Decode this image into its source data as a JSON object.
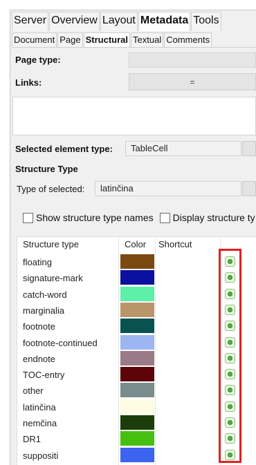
{
  "main_tabs": [
    {
      "label": "Server",
      "active": false
    },
    {
      "label": "Overview",
      "active": false
    },
    {
      "label": "Layout",
      "active": false
    },
    {
      "label": "Metadata",
      "active": true
    },
    {
      "label": "Tools",
      "active": false
    }
  ],
  "sub_tabs": [
    {
      "label": "Document",
      "active": false
    },
    {
      "label": "Page",
      "active": false
    },
    {
      "label": "Structural",
      "active": true
    },
    {
      "label": "Textual",
      "active": false
    },
    {
      "label": "Comments",
      "active": false
    }
  ],
  "page_type_label": "Page type:",
  "links_label": "Links:",
  "links_button_symbol": "=",
  "selected_element": {
    "label": "Selected element type:",
    "value": "TableCell"
  },
  "structure_type_heading": "Structure Type",
  "type_of_selected": {
    "label": "Type of selected:",
    "value": "latinčina"
  },
  "options": {
    "show_names": "Show structure type names",
    "display_types": "Display structure ty"
  },
  "table": {
    "headers": {
      "structure_type": "Structure type",
      "color": "Color",
      "shortcut": "Shortcut"
    },
    "rows": [
      {
        "name": "floating",
        "color": "#7a4a10",
        "shortcut": ""
      },
      {
        "name": "signature-mark",
        "color": "#0a10a0",
        "shortcut": ""
      },
      {
        "name": "catch-word",
        "color": "#5cf0a8",
        "shortcut": ""
      },
      {
        "name": "marginalia",
        "color": "#b8966a",
        "shortcut": ""
      },
      {
        "name": "footnote",
        "color": "#0a5252",
        "shortcut": ""
      },
      {
        "name": "footnote-continued",
        "color": "#9db6f2",
        "shortcut": ""
      },
      {
        "name": "endnote",
        "color": "#9a7a86",
        "shortcut": ""
      },
      {
        "name": "TOC-entry",
        "color": "#5c0408",
        "shortcut": ""
      },
      {
        "name": "other",
        "color": "#7a8c8c",
        "shortcut": ""
      },
      {
        "name": "latinčina",
        "color": "#fdfbe2",
        "shortcut": ""
      },
      {
        "name": "nemčina",
        "color": "#1a3d0a",
        "shortcut": ""
      },
      {
        "name": "DR1",
        "color": "#46c010",
        "shortcut": ""
      },
      {
        "name": "suppositi",
        "color": "#3c64f0",
        "shortcut": ""
      }
    ]
  },
  "highlight_color": "#e02020",
  "add_button_icon": "green-plus-icon"
}
